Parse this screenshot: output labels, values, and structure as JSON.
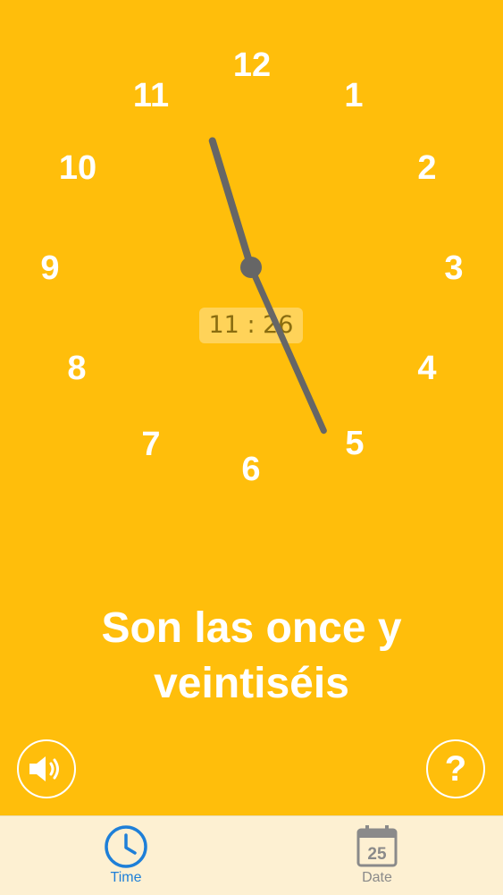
{
  "clock": {
    "numbers": [
      "12",
      "1",
      "2",
      "3",
      "4",
      "5",
      "6",
      "7",
      "8",
      "9",
      "10",
      "11"
    ],
    "digital_time": "11 : 26",
    "hour": 11,
    "minute": 26
  },
  "sentence": {
    "line1": "Son las once y",
    "line2": "veintiséis"
  },
  "buttons": {
    "help_label": "?",
    "speaker_icon": "speaker-icon"
  },
  "tabs": [
    {
      "label": "Time",
      "icon": "clock-icon",
      "selected": true
    },
    {
      "label": "Date",
      "icon": "calendar-icon",
      "icon_text": "25",
      "selected": false
    }
  ],
  "colors": {
    "background": "#FFBE0B",
    "hand": "#666666",
    "tab_active": "#1E7FD8",
    "tab_inactive": "#8A8A8A",
    "tabbar_bg": "#FDF0D2"
  }
}
